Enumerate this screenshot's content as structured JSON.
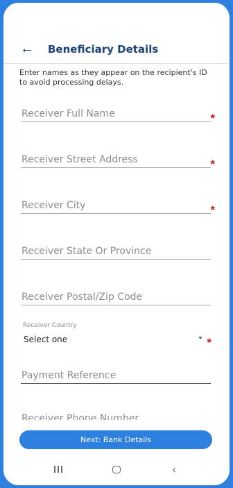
{
  "header": {
    "title": "Beneficiary Details",
    "back_icon": "arrow-left-icon"
  },
  "intro_text": "Enter names as they appear on the recipient's ID to avoid processing delays.",
  "fields": [
    {
      "label": "Receiver Full Name",
      "required": true
    },
    {
      "label": "Receiver Street Address",
      "required": true
    },
    {
      "label": "Receiver City",
      "required": true
    },
    {
      "label": "Receiver State Or Province",
      "required": false
    },
    {
      "label": "Receiver Postal/Zip Code",
      "required": false
    }
  ],
  "required_marker": "*",
  "country": {
    "label": "Receiver Country",
    "value": "Select one",
    "required": true
  },
  "payment_reference": {
    "label": "Payment Reference"
  },
  "phone_number": {
    "label": "Receiver Phone Number"
  },
  "next_button": {
    "label": "Next: Bank Details"
  },
  "colors": {
    "accent": "#2d7fe0",
    "title": "#1d4478",
    "required": "#cc1f1f"
  }
}
